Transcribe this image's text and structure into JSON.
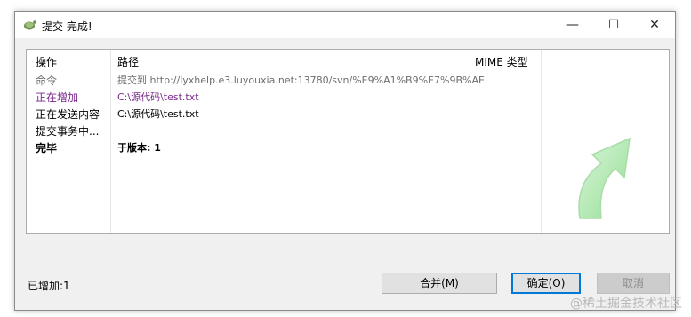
{
  "window": {
    "title": "提交 完成!"
  },
  "columns": {
    "action": "操作",
    "path": "路径",
    "mime": "MIME 类型"
  },
  "rows": [
    {
      "action": "命令",
      "path": "提交到 http://lyxhelp.e3.luyouxia.net:13780/svn/%E9%A1%B9%E7%9B%AE",
      "style": "gray"
    },
    {
      "action": "正在增加",
      "path": "C:\\源代码\\test.txt",
      "style": "purple"
    },
    {
      "action": "正在发送内容",
      "path": "C:\\源代码\\test.txt",
      "style": "black"
    },
    {
      "action": "提交事务中...",
      "path": "",
      "style": "black"
    },
    {
      "action": "完毕",
      "path": "于版本: 1",
      "style": "bold"
    }
  ],
  "status": {
    "text": "已增加:1"
  },
  "buttons": {
    "merge": "合并(M)",
    "ok": "确定(O)",
    "cancel": "取消"
  },
  "watermark": "@稀土掘金技术社区",
  "colors": {
    "accent": "#0078d7",
    "added": "#7a2a8c",
    "arrow": "#7ed87e"
  },
  "icons": {
    "app": "tortoisesvn-icon",
    "success": "green-curved-arrow-icon"
  }
}
